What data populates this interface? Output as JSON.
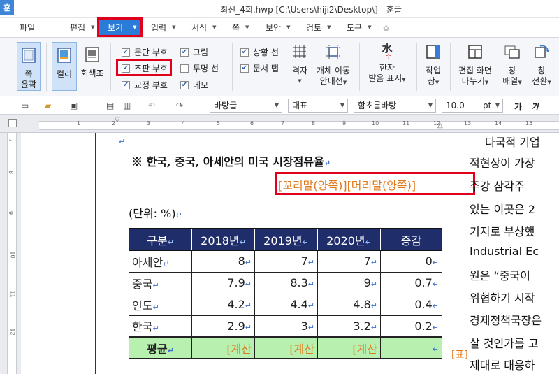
{
  "window": {
    "logo": "훈",
    "title": "최신_4회.hwp [C:\\Users\\hiji2\\Desktop\\] - 훈글"
  },
  "menu": {
    "file": "파일",
    "edit": "편집",
    "view": "보기",
    "insert": "입력",
    "format": "서식",
    "page": "쪽",
    "security": "보안",
    "review": "검토",
    "tools": "도구"
  },
  "ribbon": {
    "page_outline": [
      "쪽",
      "윤곽"
    ],
    "color": "컬러",
    "grayscale": "회색조",
    "checks": {
      "paragraph_mark": {
        "label": "문단 부호",
        "checked": true
      },
      "formatting_mark": {
        "label": "조판 부호",
        "checked": true
      },
      "proof_mark": {
        "label": "교정 부호",
        "checked": true
      },
      "picture": {
        "label": "그림",
        "checked": true
      },
      "transparent_line": {
        "label": "투명 선",
        "checked": false
      },
      "memo": {
        "label": "메모",
        "checked": true
      },
      "status_bar": {
        "label": "상황 선",
        "checked": true
      },
      "doc_tab": {
        "label": "문서 탭",
        "checked": true
      }
    },
    "grid": "격자",
    "object_move": [
      "개체 이동",
      "안내선"
    ],
    "hanja": [
      "한자",
      "발음 표시"
    ],
    "work_window": [
      "작업",
      "창"
    ],
    "split_screen": [
      "편집 화면",
      "나누기"
    ],
    "window_arrange": [
      "창",
      "배열"
    ],
    "window_switch": [
      "창",
      "전환"
    ],
    "hanja_glyph": "水",
    "hanja_sub": "수"
  },
  "toolbar": {
    "style": "바탕글",
    "lang": "대표",
    "font": "함초롬바탕",
    "size": "10.0",
    "unit": "pt",
    "ga1": "가",
    "ga2": "가"
  },
  "ruler": {
    "h": [
      "1",
      "2",
      "3",
      "4",
      "5",
      "6",
      "7",
      "8",
      "9",
      "10",
      "11",
      "12",
      "13",
      "14",
      "15"
    ],
    "v": [
      "7",
      "8",
      "9",
      "10",
      "11",
      "12"
    ]
  },
  "doc": {
    "pmark": "↵",
    "heading": "※ 한국, 중국, 아세안의 미국 시장점유율",
    "field_codes": "[꼬리말(양쪽)][머리말(양쪽)]",
    "unit": "(단위: %)",
    "table": {
      "header": [
        "구분",
        "2018년",
        "2019년",
        "2020년",
        "증감"
      ],
      "rows": [
        [
          "아세안",
          "8",
          "7",
          "7",
          "0"
        ],
        [
          "중국",
          "7.9",
          "8.3",
          "9",
          "0.7"
        ],
        [
          "인도",
          "4.2",
          "4.4",
          "4.8",
          "0.4"
        ],
        [
          "한국",
          "2.9",
          "3",
          "3.2",
          "0.2"
        ]
      ],
      "sum": [
        "평균",
        "[계산",
        "[계산",
        "[계산",
        ""
      ]
    },
    "table_tag": "[표]",
    "right_col": [
      "다국적 기업",
      "적현상이 가장",
      "주강 삼각주",
      "있는 이곳은 2",
      "기지로 부상했",
      "Industrial Ec",
      "원은 “중국이",
      "위협하기 시작",
      "경제정책국장은",
      "살 것인가를 고",
      "제대로 대응하"
    ]
  }
}
